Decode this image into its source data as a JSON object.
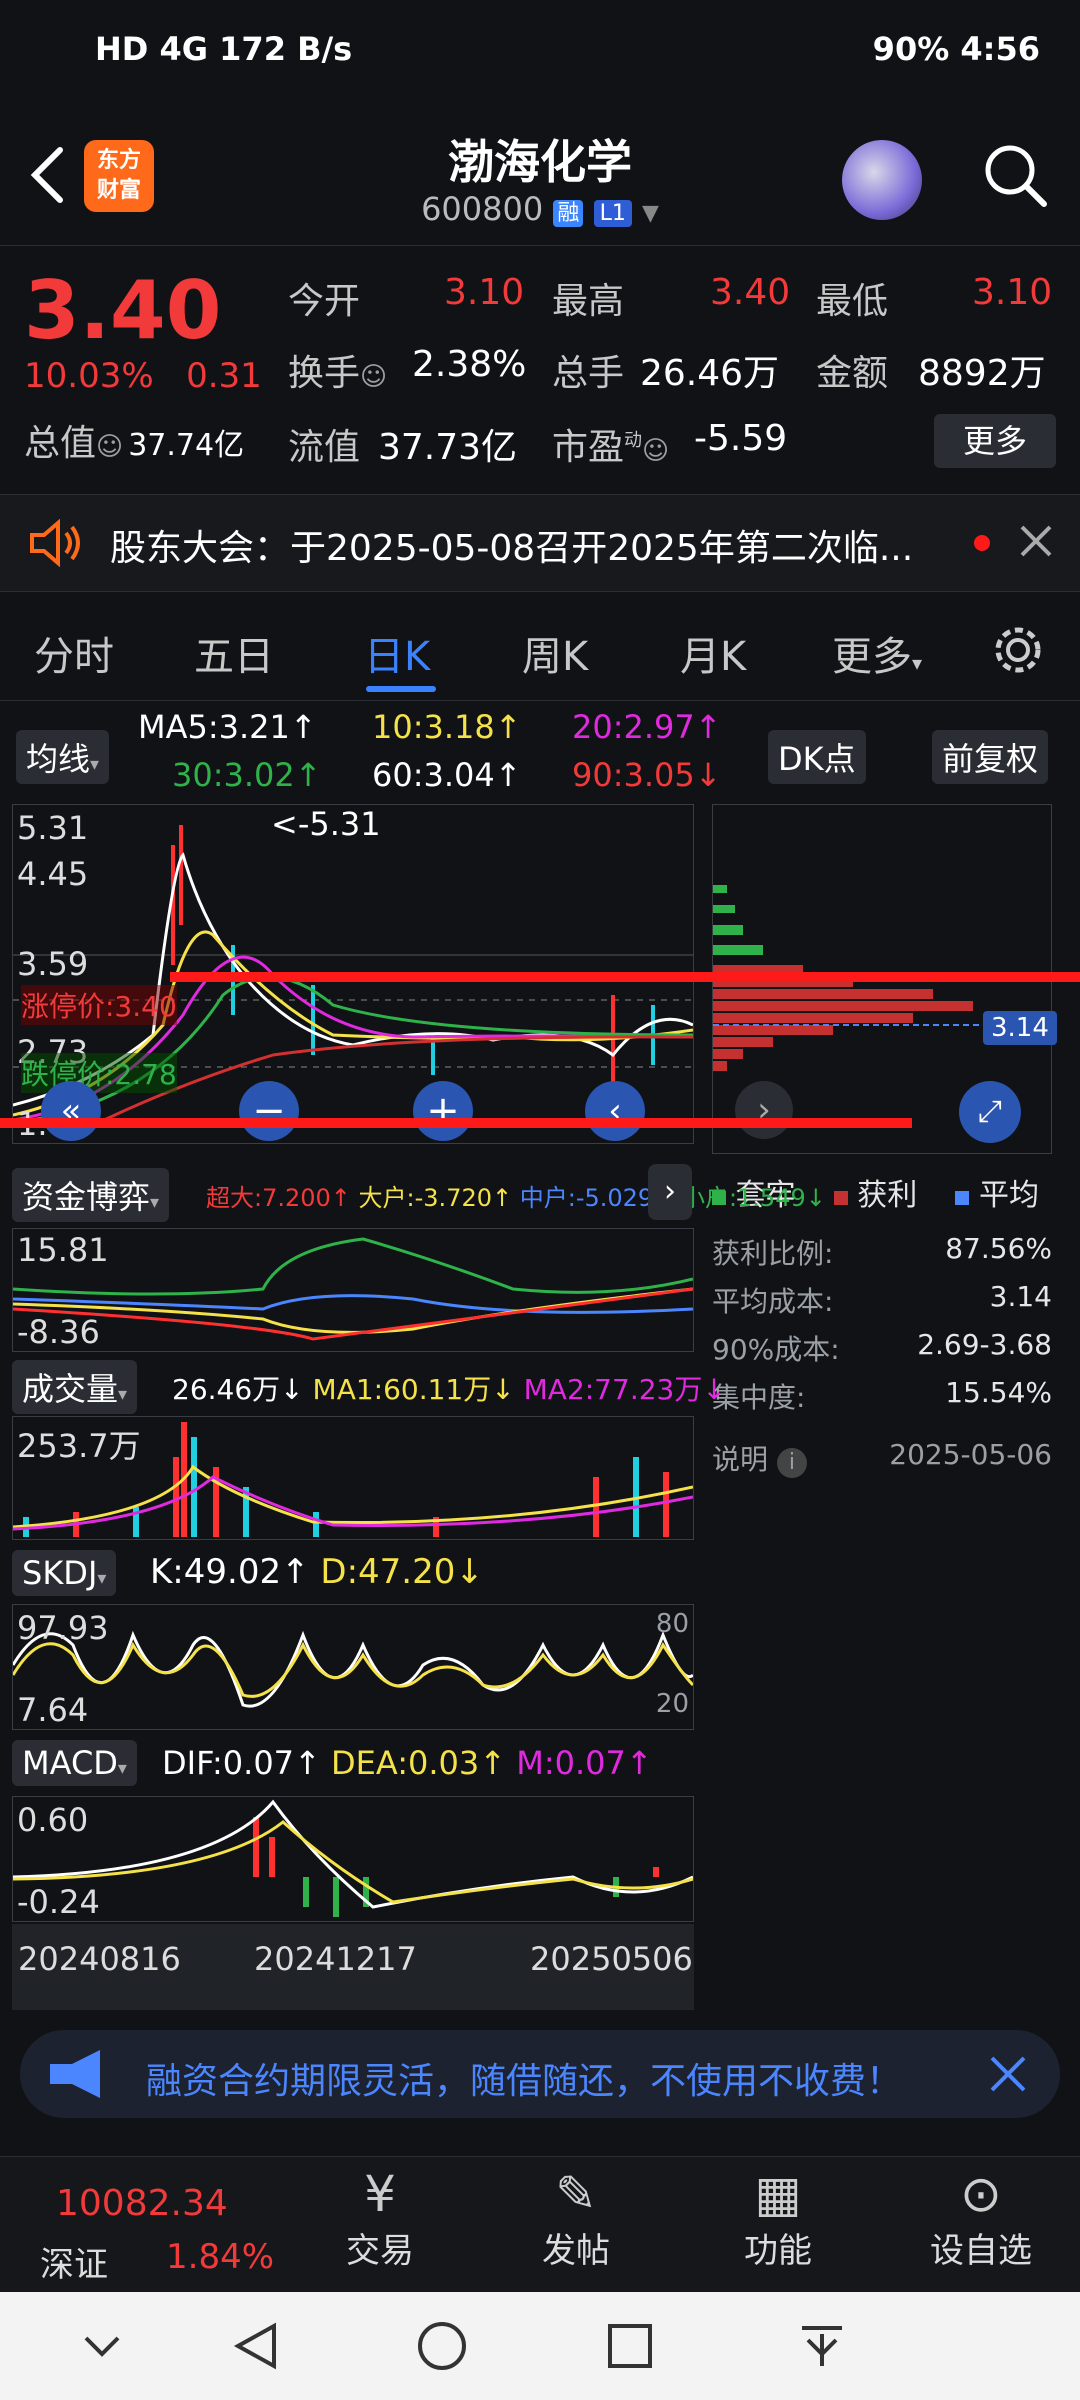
{
  "status_bar": {
    "left": "HD 4G  172 B/s",
    "right": "90%  4:56"
  },
  "header": {
    "title": "渤海化学",
    "code": "600800",
    "badge_margin": "融",
    "badge_level": "L1",
    "logo_text_1": "东方",
    "logo_text_2": "财富"
  },
  "quote": {
    "price": "3.40",
    "change_pct": "10.03%",
    "change_amt": "0.31",
    "open_label": "今开",
    "open": "3.10",
    "high_label": "最高",
    "high": "3.40",
    "low_label": "最低",
    "low": "3.10",
    "turnover_label": "换手",
    "turnover": "2.38%",
    "volume_label": "总手",
    "volume": "26.46万",
    "amount_label": "金额",
    "amount": "8892万",
    "mktcap_label": "总值",
    "mktcap": "37.74亿",
    "float_label": "流值",
    "float": "37.73亿",
    "pe_label": "市盈",
    "pe_sup": "动",
    "pe": "-5.59",
    "more_btn": "更多"
  },
  "notice": {
    "text": "股东大会：于2025-05-08召开2025年第二次临..."
  },
  "tabs": [
    "分时",
    "五日",
    "日K",
    "周K",
    "月K",
    "更多"
  ],
  "active_tab": "日K",
  "ma": {
    "chip": "均线",
    "ma5": "MA5:3.21↑",
    "ma10": "10:3.18↑",
    "ma20": "20:2.97↑",
    "ma30": "30:3.02↑",
    "ma60": "60:3.04↑",
    "ma90": "90:3.05↓",
    "dk_btn": "DK点",
    "adjust_btn": "前复权"
  },
  "main_chart": {
    "y_top": "5.31",
    "y_2": "4.45",
    "y_3": "3.59",
    "y_4": "2.73",
    "y_bottom": "1.87",
    "peak_label": "<-5.31",
    "limit_up": "涨停价:3.40",
    "limit_down": "跌停价:2.78"
  },
  "chip_distribution": {
    "avg_cost_tag": "3.14",
    "legend_trapped": "套牢",
    "legend_profit": "获利",
    "legend_avg": "平均",
    "rows": [
      {
        "label": "获利比例:",
        "value": "87.56%"
      },
      {
        "label": "平均成本:",
        "value": "3.14"
      },
      {
        "label": "90%成本:",
        "value": "2.69-3.68"
      },
      {
        "label": "集中度:",
        "value": "15.54%"
      }
    ],
    "note_label": "说明",
    "note_date": "2025-05-06"
  },
  "capital_flow": {
    "chip": "资金博弈",
    "super": "超大:7.200↑",
    "big": "大户:-3.720↑",
    "mid": "中户:-5.029↓",
    "small": "小户:1.549↓",
    "y_top": "15.81",
    "y_bottom": "-8.36"
  },
  "volume_panel": {
    "chip": "成交量",
    "vol": "26.46万↓",
    "ma1": "MA1:60.11万↓",
    "ma2": "MA2:77.23万↓",
    "y_top": "253.7万"
  },
  "skdj": {
    "chip": "SKDJ",
    "k": "K:49.02↑",
    "d": "D:47.20↓",
    "y_top": "97.93",
    "y_bottom": "7.64",
    "r80": "80",
    "r20": "20"
  },
  "macd": {
    "chip": "MACD",
    "dif": "DIF:0.07↑",
    "dea": "DEA:0.03↑",
    "m": "M:0.07↑",
    "y_top": "0.60",
    "y_bottom": "-0.24"
  },
  "x_axis": [
    "20240816",
    "20241217",
    "20250506"
  ],
  "ad": {
    "text": "融资合约期限灵活，随借随还，不使用不收费！"
  },
  "bottom_nav": {
    "index_value": "10082.34",
    "index_name": "深证",
    "index_change": "1.84%",
    "items": [
      "交易",
      "发帖",
      "功能",
      "设自选"
    ]
  }
}
